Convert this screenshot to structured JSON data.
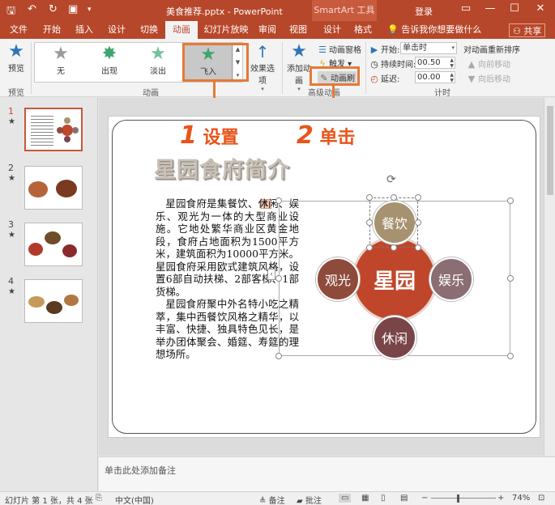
{
  "titlebar": {
    "doc_title": "美食推荐.pptx - PowerPoint",
    "context_tab": "SmartArt 工具",
    "login": "登录",
    "icons": [
      "save-icon",
      "undo-icon",
      "redo-icon",
      "start-from-beginning-icon",
      "customize-qat-icon"
    ],
    "window_controls": [
      "restore-ribbon-icon",
      "minimize-icon",
      "maximize-icon",
      "close-icon"
    ]
  },
  "tabs": [
    "文件",
    "开始",
    "插入",
    "设计",
    "切换",
    "动画",
    "幻灯片放映",
    "审阅",
    "视图",
    "设计",
    "格式"
  ],
  "active_tab": "动画",
  "tell_me": "告诉我你想要做什么",
  "share": "共享",
  "ribbon": {
    "preview": {
      "label": "预览",
      "group": "预览"
    },
    "gallery": [
      {
        "label": "无"
      },
      {
        "label": "出现"
      },
      {
        "label": "淡出"
      },
      {
        "label": "飞入",
        "selected": true
      }
    ],
    "effect_options": "效果选项",
    "animation_group": "动画",
    "add_animation": "添加动画",
    "animation_pane": "动画窗格",
    "trigger": "触发",
    "animation_painter": "动画刷",
    "advanced_group": "高级动画",
    "start_label": "开始:",
    "start_value": "单击时",
    "duration_label": "持续时间:",
    "duration_value": "00.50",
    "delay_label": "延迟:",
    "delay_value": "00.00",
    "reorder_title": "对动画重新排序",
    "move_earlier": "向前移动",
    "move_later": "向后移动",
    "timing_group": "计时"
  },
  "callouts": [
    {
      "num": "1",
      "text": "设置"
    },
    {
      "num": "2",
      "text": "单击"
    }
  ],
  "thumbnails": [
    {
      "num": "1",
      "star": "★"
    },
    {
      "num": "2",
      "star": "★"
    },
    {
      "num": "3",
      "star": "★"
    },
    {
      "num": "4",
      "star": "★"
    }
  ],
  "slide": {
    "title": "星园食府简介",
    "anim_tag": "1",
    "paragraph1": "星园食府是集餐饮、休闲、娱乐、观光为一体的大型商业设施。它地处繁华商业区黄金地段，食府占地面积为1500平方米，建筑面积为10000平方米。星园食府采用欧式建筑风格，设置6部自动扶梯、2部客梯、1部货梯。",
    "paragraph2": "星园食府聚中外名特小吃之精萃，集中西餐饮风格之精华，以丰富、快捷、独具特色见长，是举办团体聚会、婚筵、寿筵的理想场所。",
    "smartart": {
      "center": "星园",
      "top": "餐饮",
      "left": "观光",
      "right": "娱乐",
      "bottom": "休闲"
    }
  },
  "notes_placeholder": "单击此处添加备注",
  "status": {
    "slide_info": "幻灯片 第 1 张，共 4 张",
    "language": "中文(中国)",
    "notes": "备注",
    "comments": "批注",
    "zoom": "74%"
  }
}
